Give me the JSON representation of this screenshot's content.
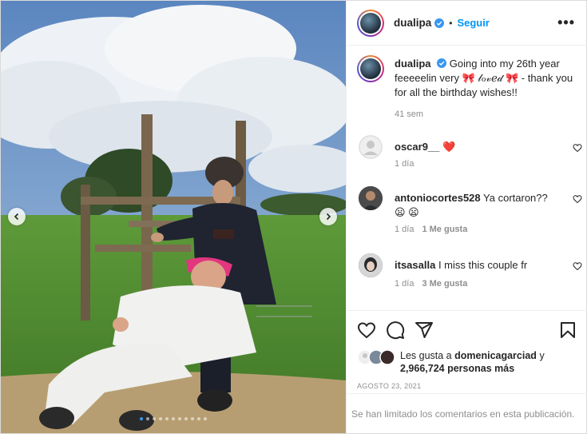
{
  "post": {
    "username": "dualipa",
    "follow_label": "Seguir",
    "more_label": "•••",
    "caption_text": "Going into my 26th year feeeeelin very 🎀 𝓁ℴ𝓋ℯ𝒹 🎀 - thank you for all the birthday wishes!!",
    "caption_time": "41 sem",
    "carousel": {
      "slides": 11,
      "active_index": 0
    }
  },
  "comments": [
    {
      "username": "oscar9__",
      "text": "❤️",
      "time": "1 día",
      "likes": ""
    },
    {
      "username": "antoniocortes528",
      "text": "Ya cortaron?? 😦 😦",
      "time": "1 día",
      "likes": "1 Me gusta"
    },
    {
      "username": "itsasalla",
      "text": "I miss this couple fr",
      "time": "1 día",
      "likes": "3 Me gusta"
    }
  ],
  "actions": {
    "likes_prefix": "Les gusta a",
    "likes_user": "domenicagarciad",
    "likes_and": "y",
    "likes_count": "2,966,724 personas más",
    "date": "AGOSTO 23, 2021"
  },
  "footer": {
    "limited_text": "Se han limitado los comentarios en esta publicación."
  },
  "icons": [
    "verified-icon",
    "more-icon",
    "heart-icon",
    "comment-icon",
    "share-icon",
    "save-icon",
    "chevron-left-icon",
    "chevron-right-icon"
  ],
  "colors": {
    "link": "#0095f6",
    "verified": "#3897f0",
    "muted": "#8e8e8e",
    "text": "#262626"
  }
}
